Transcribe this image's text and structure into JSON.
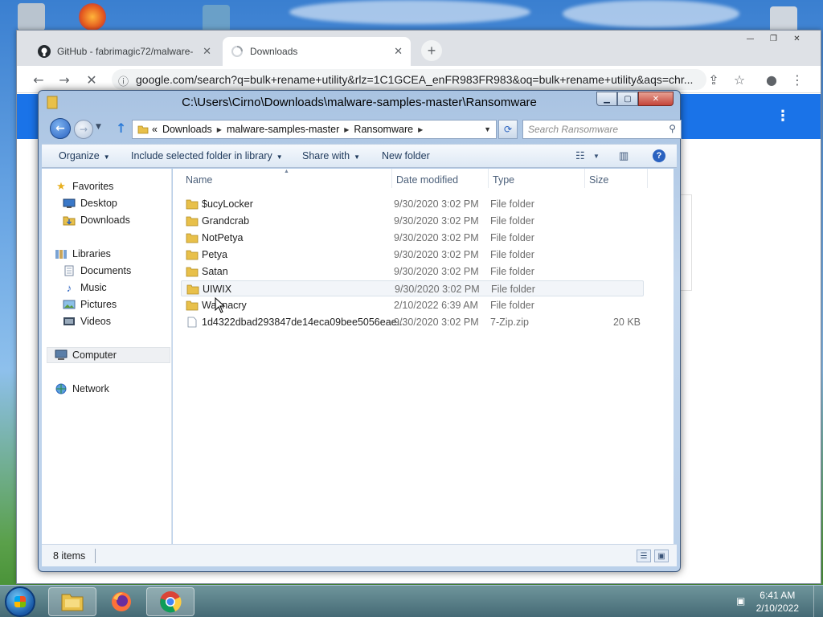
{
  "browser": {
    "tabs": [
      {
        "label": "GitHub - fabrimagic72/malware-",
        "icon": "github-icon"
      },
      {
        "label": "Downloads",
        "icon": "loading-spinner-icon"
      }
    ],
    "url": "google.com/search?q=bulk+rename+utility&rlz=1C1GCEA_enFR983FR983&oq=bulk+rename+utility&aqs=chr..."
  },
  "explorer": {
    "title": "C:\\Users\\Cirno\\Downloads\\malware-samples-master\\Ransomware",
    "breadcrumb": [
      "Downloads",
      "malware-samples-master",
      "Ransomware"
    ],
    "breadcrumb_prefix": "«",
    "search_placeholder": "Search Ransomware",
    "commands": {
      "organize": "Organize",
      "include": "Include selected folder in library",
      "share": "Share with",
      "new_folder": "New folder"
    },
    "nav": {
      "favorites": "Favorites",
      "desktop": "Desktop",
      "downloads": "Downloads",
      "libraries": "Libraries",
      "documents": "Documents",
      "music": "Music",
      "pictures": "Pictures",
      "videos": "Videos",
      "computer": "Computer",
      "network": "Network"
    },
    "columns": {
      "name": "Name",
      "date": "Date modified",
      "type": "Type",
      "size": "Size"
    },
    "files": [
      {
        "name": "$ucyLocker",
        "date": "9/30/2020 3:02 PM",
        "type": "File folder",
        "size": ""
      },
      {
        "name": "Grandcrab",
        "date": "9/30/2020 3:02 PM",
        "type": "File folder",
        "size": ""
      },
      {
        "name": "NotPetya",
        "date": "9/30/2020 3:02 PM",
        "type": "File folder",
        "size": ""
      },
      {
        "name": "Petya",
        "date": "9/30/2020 3:02 PM",
        "type": "File folder",
        "size": ""
      },
      {
        "name": "Satan",
        "date": "9/30/2020 3:02 PM",
        "type": "File folder",
        "size": ""
      },
      {
        "name": "UIWIX",
        "date": "9/30/2020 3:02 PM",
        "type": "File folder",
        "size": ""
      },
      {
        "name": "Wannacry",
        "date": "2/10/2022 6:39 AM",
        "type": "File folder",
        "size": ""
      },
      {
        "name": "1d4322dbad293847de14eca09bee5056eae...",
        "date": "9/30/2020 3:02 PM",
        "type": "7-Zip.zip",
        "size": "20 KB"
      }
    ],
    "status_count": "8 items"
  },
  "taskbar": {
    "time": "6:41 AM",
    "date": "2/10/2022"
  },
  "colors": {
    "chrome_accent": "#1a73e8",
    "folder_yellow": "#e8c04a"
  }
}
